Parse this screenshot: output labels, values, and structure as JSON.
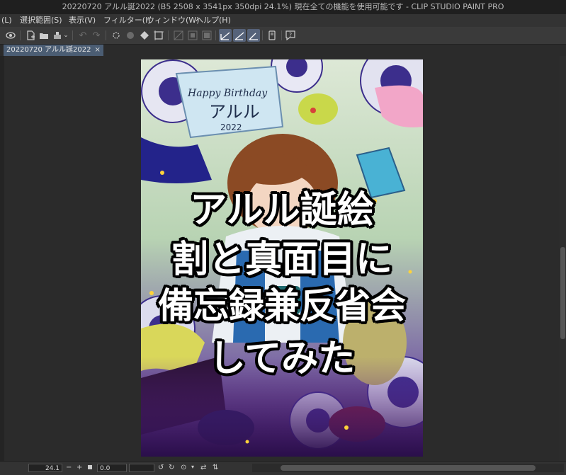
{
  "window": {
    "title": "20220720 アルル誕2022 (B5 2508 x 3541px 350dpi 24.1%)  現在全ての機能を使用可能です - CLIP STUDIO PAINT PRO"
  },
  "menu": {
    "items": [
      "(L)",
      "選択範囲(S)",
      "表示(V)",
      "フィルター(I)",
      "ウィンドウ(W)",
      "ヘルプ(H)"
    ]
  },
  "toolbar": {
    "icons": [
      "navigator-icon",
      "new-file-icon",
      "open-folder-icon",
      "save-icon",
      "chevron-down-icon",
      "undo-icon",
      "redo-icon",
      "clear-icon",
      "fill-icon",
      "transform-icon",
      "select-icon",
      "ruler-icon",
      "snap-icon",
      "grid-icon",
      "pen-stroke-icon",
      "brush-stroke-icon",
      "line-stroke-icon",
      "tablet-icon",
      "help-icon"
    ]
  },
  "tabs": [
    {
      "label": "20220720 アルル誕2022",
      "close": "×"
    }
  ],
  "canvas": {
    "overlay_lines": [
      "アルル誕絵",
      "割と真面目に",
      "備忘録兼反省会",
      "してみた"
    ],
    "flag_text": [
      "Happy Birthday",
      "アルル",
      "2022"
    ],
    "artwork_palette": {
      "sky_green": "#c5dcb6",
      "sunflower_purple": "#3c2e8c",
      "petal_white": "#e8e8f4",
      "hair_brown": "#8b4a24",
      "shirt_blue": "#2a6ab0",
      "bag_blue": "#49b2d4",
      "bottom_violet": "#5a1e88"
    }
  },
  "status": {
    "zoom": "24.1",
    "minus": "−",
    "plus": "+",
    "angle": "0.0"
  },
  "colors": {
    "accent": "#56637a",
    "tab_active": "#4b5d73"
  }
}
